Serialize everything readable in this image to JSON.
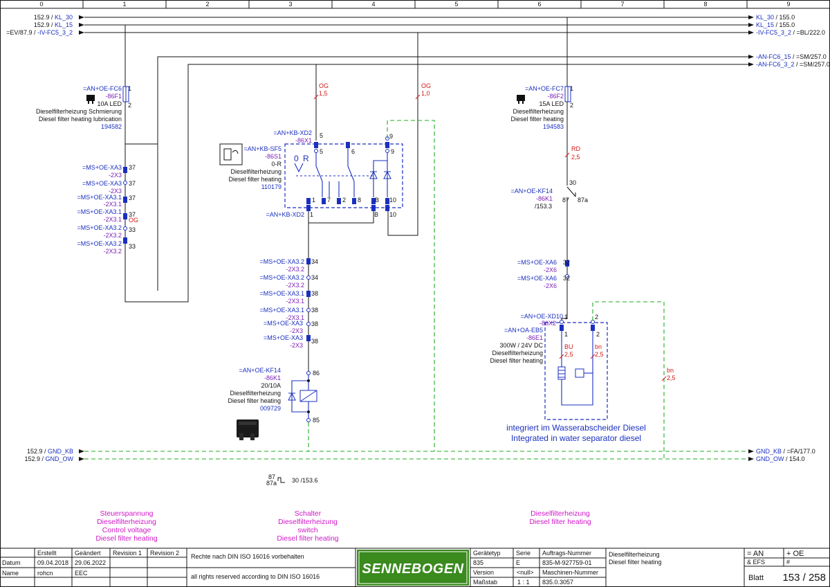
{
  "columns": [
    "0",
    "1",
    "2",
    "3",
    "4",
    "5",
    "6",
    "7",
    "8",
    "9"
  ],
  "busbars": {
    "left": [
      {
        "ref": "152.9 /",
        "name": "KL_30"
      },
      {
        "ref": "152.9 /",
        "name": "KL_15"
      },
      {
        "ref": "=EV/87.9 /",
        "name": "-IV-FC5_3_2"
      }
    ],
    "right": [
      {
        "name": "KL_30",
        "ref": "/ 155.0"
      },
      {
        "name": "KL_15",
        "ref": "/ 155.0"
      },
      {
        "name": "-IV-FC5_3_2",
        "ref": "/ =BL/222.0"
      },
      {
        "name": "-AN-FC6_15",
        "ref": "/ =SM/257.0"
      },
      {
        "name": "-AN-FC6_3_2",
        "ref": "/ =SM/257.0"
      }
    ],
    "gnd_left": [
      {
        "ref": "152.9 /",
        "name": "GND_KB"
      },
      {
        "ref": "152.9 /",
        "name": "GND_OW"
      }
    ],
    "gnd_right": [
      {
        "name": "GND_KB",
        "ref": "/ =FA/177.0"
      },
      {
        "name": "GND_OW",
        "ref": "/ 154.0"
      }
    ]
  },
  "fuse1": {
    "tag": "=AN+OE-FC6",
    "id": "-86F1",
    "pin1": "1",
    "pin2": "2",
    "rating": "10A LED",
    "desc_de": "Dieselfilterheizung Schmierung",
    "desc_en": "Diesel filter heating lubrication",
    "part": "194582"
  },
  "fuse2": {
    "tag": "=AN+OE-FC7",
    "id": "-86F2",
    "pin1": "1",
    "pin2": "2",
    "rating": "15A LED",
    "desc_de": "Dieselfilterheizung",
    "desc_en": "Diesel filter heating",
    "part": "194583"
  },
  "left_connectors": [
    {
      "tag": "=MS+OE-XA3",
      "id": "-2X3",
      "pin": "37"
    },
    {
      "tag": "=MS+OE-XA3",
      "id": "-2X3",
      "pin": "37"
    },
    {
      "tag": "=MS+OE-XA3.1",
      "id": "-2X3.1",
      "pin": "37"
    },
    {
      "tag": "=MS+OE-XA3.1",
      "id": "-2X3.1",
      "pin": "37"
    },
    {
      "tag": "=MS+OE-XA3.2",
      "id": "-2X3.2",
      "pin": "33"
    },
    {
      "tag": "=MS+OE-XA3.2",
      "id": "-2X3.2",
      "pin": "33"
    }
  ],
  "left_wire_color": "OG",
  "wire_og_15": {
    "color": "OG",
    "size": "1,5"
  },
  "wire_og_10": {
    "color": "OG",
    "size": "1,0"
  },
  "switch": {
    "plug_tag": "=AN+KB-XD2",
    "plug_id": "-86X1",
    "tag": "=AN+KB-SF5",
    "id": "-86S1",
    "mode": "0-R",
    "desc_de": "Dieselfilterheizung",
    "desc_en": "Diesel filter heating",
    "part": "110179",
    "pos0": "0",
    "posR": "R",
    "top_pins": [
      "5",
      "5",
      "6",
      "9",
      "9"
    ],
    "bottom_pins": [
      "1",
      "7",
      "2",
      "8",
      "B",
      "10"
    ],
    "lower_plug_tag": "=AN+KB-XD2",
    "lower_pins": [
      "1",
      "B",
      "10"
    ]
  },
  "mid_connectors": [
    {
      "tag": "=MS+OE-XA3.2",
      "id": "-2X3.2",
      "pin": "34"
    },
    {
      "tag": "=MS+OE-XA3.2",
      "id": "-2X3.2",
      "pin": "34"
    },
    {
      "tag": "=MS+OE-XA3.1",
      "id": "-2X3.1",
      "pin": "38"
    },
    {
      "tag": "=MS+OE-XA3.1",
      "id": "-2X3.1",
      "pin": "38"
    },
    {
      "tag": "=MS+OE-XA3",
      "id": "-2X3",
      "pin": "38"
    },
    {
      "tag": "=MS+OE-XA3",
      "id": "-2X3",
      "pin": "38"
    }
  ],
  "relay1": {
    "tag": "=AN+OE-KF14",
    "id": "-86K1",
    "rating": "20/10A",
    "desc_de": "Dieselfilterheizung",
    "desc_en": "Diesel filter heating",
    "part": "009729",
    "pin_top": "86",
    "pin_bot": "85",
    "contact_ref_87": "87",
    "contact_ref_87a": "87a",
    "contact_ref_30": "30 /153.6"
  },
  "relay_contact": {
    "wire_color": "RD",
    "wire_size": "2,5",
    "pin30": "30",
    "tag": "=AN+OE-KF14",
    "id": "-86K1",
    "pin87": "87",
    "pin87a": "87a",
    "ref": "/153.3"
  },
  "right_connectors": [
    {
      "tag": "=MS+OE-XA6",
      "id": "-2X6",
      "pin": "32"
    },
    {
      "tag": "=MS+OE-XA6",
      "id": "-2X6",
      "pin": "32"
    }
  ],
  "heater": {
    "plug_tag": "=AN+OE-XD10",
    "plug_id": "-86X2",
    "pin1": "1",
    "pin2": "2",
    "tag": "=AN+OA-EB5",
    "id": "-86E1",
    "rating": "300W / 24V DC",
    "desc_de": "Dieselfilterheizung",
    "desc_en": "Diesel filter heating",
    "w1_color": "BU",
    "w1_size": "2,5",
    "w2_color": "bn",
    "w2_size": "2,5",
    "note_de": "integriert im Wasserabscheider Diesel",
    "note_en": "Integrated in water separator diesel"
  },
  "wire_bn": {
    "color": "bn",
    "size": "2,5"
  },
  "footer_labels": [
    {
      "lines": [
        "Steuerspannung",
        "Dieselfilterheizung",
        "Control voltage",
        "Diesel filter heating"
      ]
    },
    {
      "lines": [
        "Schalter",
        "Dieselfilterheizung",
        "switch",
        "Diesel filter heating"
      ]
    },
    {
      "lines": [
        "Dieselfilterheizung",
        "Diesel filter heating"
      ]
    }
  ],
  "title_block": {
    "h_erstellt": "Erstellt",
    "h_geaendert": "Geändert",
    "h_rev1": "Revision 1",
    "h_rev2": "Revision 2",
    "datum_label": "Datum",
    "datum_erstellt": "09.04.2018",
    "datum_geaendert": "29.06.2022",
    "name_label": "Name",
    "name_erstellt": "rohcn",
    "name_geaendert": "EEC",
    "rights_de": "Rechte nach DIN ISO 16016 vorbehalten",
    "rights_en": "all rights reserved according to DIN ISO 16016",
    "logo": "SENNEBOGEN",
    "geraetetyp_label": "Gerätetyp",
    "serie_label": "Serie",
    "auftrag_label": "Auftrags-Nummer",
    "geraetetyp": "835",
    "serie": "E",
    "auftrag": "835-M-927759-01",
    "version_label": "Version",
    "version": "<null>",
    "maschine_label": "Maschinen-Nummer",
    "massstab_label": "Maßstab",
    "massstab": "1 : 1",
    "maschine": "835.0.3057",
    "title_de": "Dieselfilterheizung",
    "title_en": "Diesel filter heating",
    "eq_an": "= AN",
    "eq_oe": "+ OE",
    "efs": "& EFS",
    "hash": "#",
    "blatt_label": "Blatt",
    "blatt": "153 / 258"
  },
  "colors": {
    "blue": "#1a2fbf",
    "purple": "#7a1fb5",
    "red": "#d01818",
    "green": "#1fae1f",
    "magenta": "#d017c8",
    "logo_green": "#3a8a1e"
  }
}
